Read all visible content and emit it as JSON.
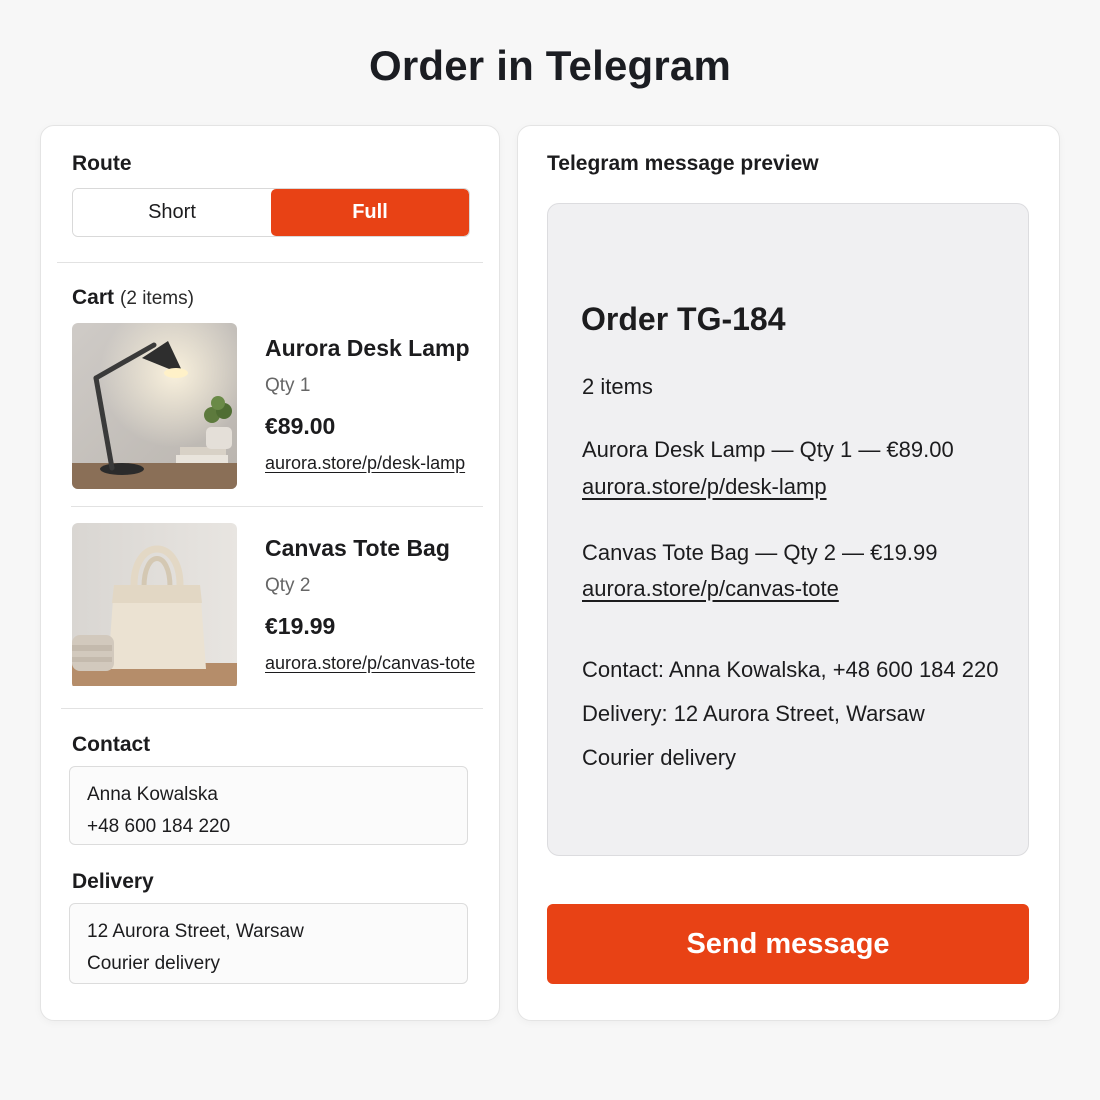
{
  "page": {
    "title": "Order in Telegram"
  },
  "route": {
    "label": "Route",
    "options": [
      "Short",
      "Full"
    ],
    "selected": "Full"
  },
  "cart": {
    "label": "Cart",
    "count": "(2 items)",
    "items": [
      {
        "name": "Aurora Desk Lamp",
        "qty": "Qty 1",
        "price": "€89.00",
        "link": "aurora.store/p/desk-lamp",
        "image": "desk-lamp-photo"
      },
      {
        "name": "Canvas Tote Bag",
        "qty": "Qty 2",
        "price": "€19.99",
        "link": "aurora.store/p/canvas-tote",
        "image": "tote-bag-photo"
      }
    ]
  },
  "contact": {
    "label": "Contact",
    "name": "Anna Kowalska",
    "phone": "+48 600 184 220"
  },
  "delivery": {
    "label": "Delivery",
    "address": "12 Aurora Street, Warsaw",
    "method": "Courier delivery"
  },
  "preview": {
    "label": "Telegram message preview",
    "order_title": "Order TG-184",
    "items_count": "2 items",
    "lines": [
      {
        "text": "Aurora Desk Lamp — Qty 1 — €89.00",
        "link": "aurora.store/p/desk-lamp"
      },
      {
        "text": "Canvas Tote Bag — Qty 2 — €19.99",
        "link": "aurora.store/p/canvas-tote"
      }
    ],
    "contact_line": "Contact: Anna Kowalska, +48 600 184 220",
    "delivery_line": "Delivery: 12 Aurora Street, Warsaw",
    "method_line": "Courier delivery"
  },
  "actions": {
    "send_label": "Send message"
  },
  "colors": {
    "accent": "#e84215",
    "preview_bg": "#f0f0f2",
    "card_bg": "#ffffff",
    "page_bg": "#f7f7f7"
  }
}
